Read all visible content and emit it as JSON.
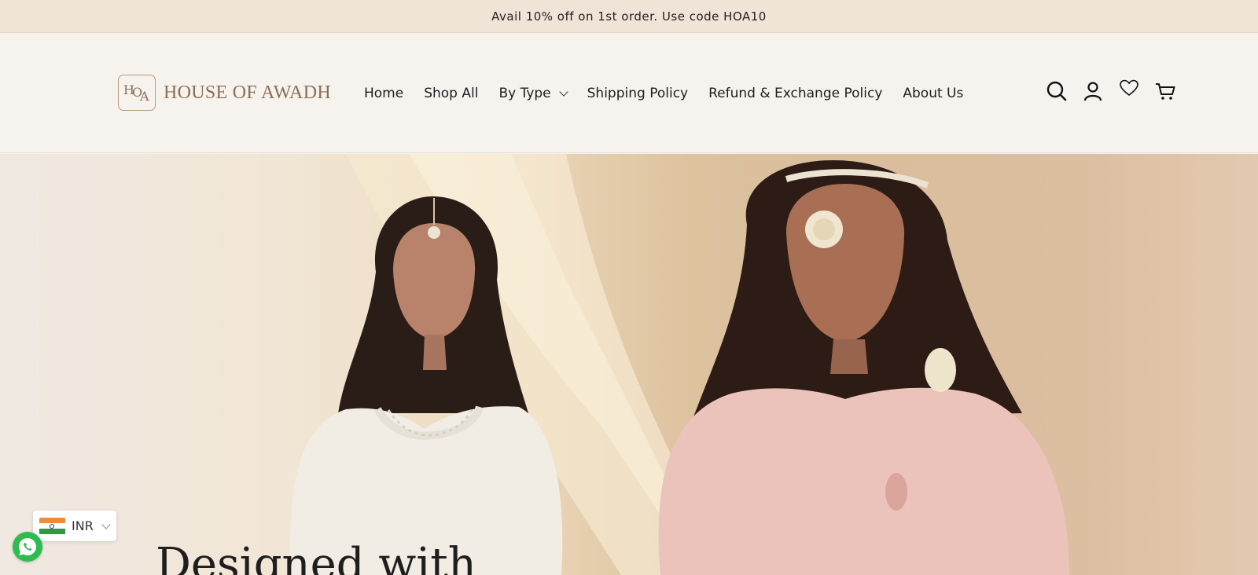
{
  "announcement": {
    "text": "Avail 10% off on 1st order. Use code HOA10"
  },
  "header": {
    "logo_text": "HOUSE OF AWADH",
    "nav": [
      {
        "label": "Home"
      },
      {
        "label": "Shop All"
      },
      {
        "label": "By Type",
        "has_dropdown": true
      },
      {
        "label": "Shipping Policy"
      },
      {
        "label": "Refund & Exchange Policy"
      },
      {
        "label": "About Us"
      }
    ],
    "icons": [
      "search-icon",
      "account-icon",
      "wishlist-heart-icon",
      "cart-icon"
    ]
  },
  "hero": {
    "heading": "Designed with"
  },
  "currency_selector": {
    "code": "INR",
    "flag": "india-flag-icon"
  },
  "floating": {
    "whatsapp_icon": "whatsapp-icon"
  },
  "colors": {
    "announcement_bg": "#efe4d6",
    "header_bg": "#f6f2ee",
    "logo": "#8c6f55",
    "whatsapp": "#2dbd4f"
  }
}
